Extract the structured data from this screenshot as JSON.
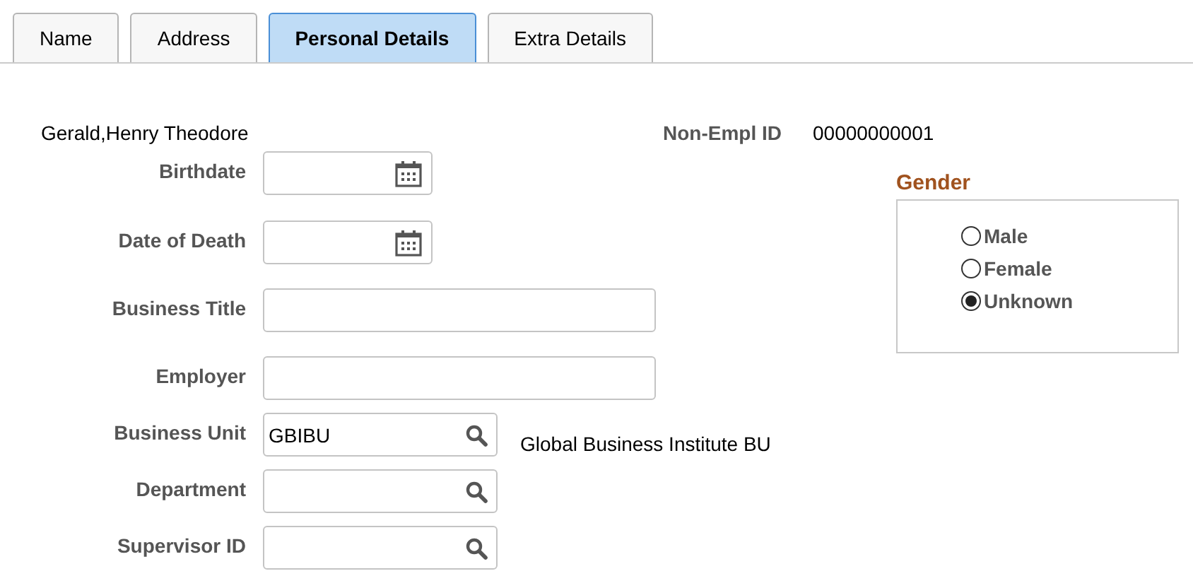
{
  "tabs": [
    {
      "label": "Name",
      "selected": false
    },
    {
      "label": "Address",
      "selected": false
    },
    {
      "label": "Personal Details",
      "selected": true
    },
    {
      "label": "Extra Details",
      "selected": false
    }
  ],
  "person_name": "Gerald,Henry Theodore",
  "non_empl_id": {
    "label": "Non-Empl ID",
    "value": "00000000001"
  },
  "fields": [
    {
      "label": "Birthdate",
      "kind": "date"
    },
    {
      "label": "Date of Death",
      "kind": "date"
    },
    {
      "label": "Business Title",
      "kind": "text"
    },
    {
      "label": "Employer",
      "kind": "text"
    },
    {
      "label": "Business Unit",
      "kind": "lookup",
      "value": "GBIBU",
      "description": "Global Business Institute BU"
    },
    {
      "label": "Department",
      "kind": "lookup"
    },
    {
      "label": "Supervisor ID",
      "kind": "lookup"
    }
  ],
  "gender": {
    "title": "Gender",
    "options": [
      {
        "label": "Male",
        "selected": false
      },
      {
        "label": "Female",
        "selected": false
      },
      {
        "label": "Unknown",
        "selected": true
      }
    ]
  }
}
